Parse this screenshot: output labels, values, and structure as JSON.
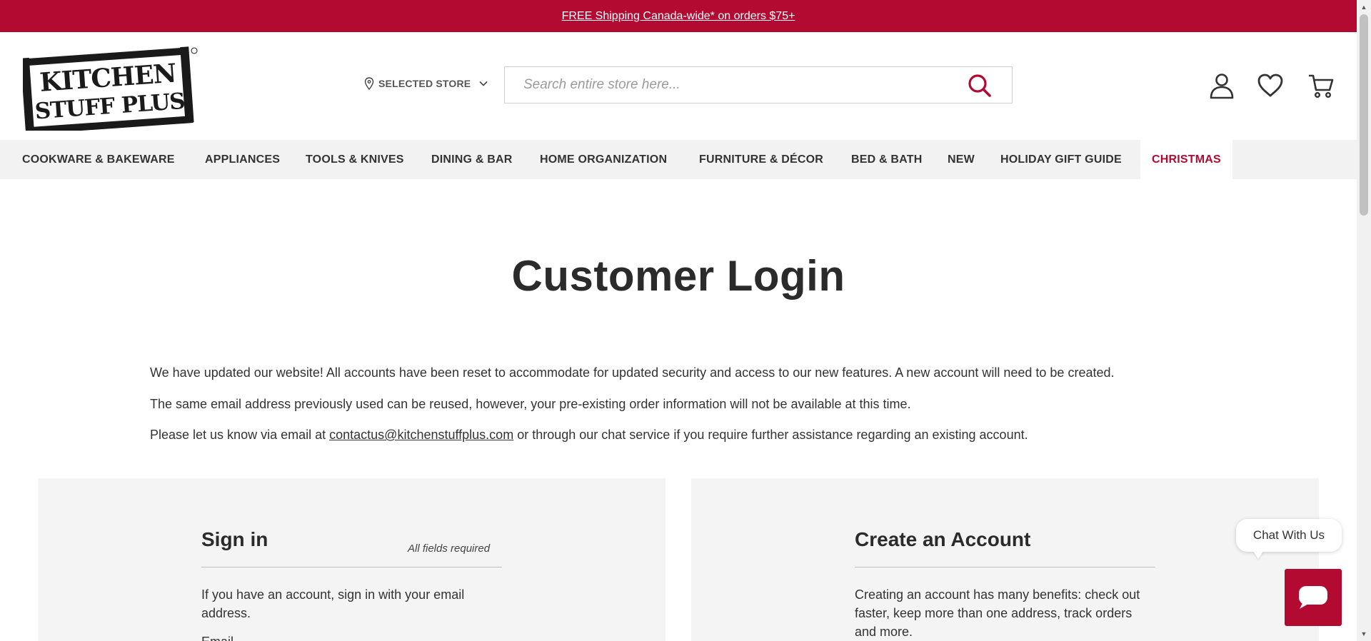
{
  "promo": {
    "text": "FREE Shipping Canada-wide* on orders $75+"
  },
  "header": {
    "logo_alt": "KITCHEN STUFF PLUS",
    "store_label": "SELECTED STORE",
    "search_placeholder": "Search entire store here...",
    "icons": [
      "account-icon",
      "wishlist-heart-icon",
      "cart-icon"
    ]
  },
  "nav": {
    "items": [
      {
        "label": "COOKWARE & BAKEWARE"
      },
      {
        "label": "APPLIANCES"
      },
      {
        "label": "TOOLS & KNIVES"
      },
      {
        "label": "DINING & BAR"
      },
      {
        "label": "HOME ORGANIZATION"
      },
      {
        "label": "FURNITURE & DÉCOR"
      },
      {
        "label": "BED & BATH"
      },
      {
        "label": "NEW"
      },
      {
        "label": "HOLIDAY GIFT GUIDE"
      },
      {
        "label": "CHRISTMAS"
      }
    ]
  },
  "main": {
    "title": "Customer Login",
    "notice_1": "We have updated our website! All accounts have been reset to accommodate for updated security and access to our new features. A new account will need to be created.",
    "notice_2": "The same email address previously used can be reused, however, your pre-existing order information will not be available at this time.",
    "notice_3_prefix": "Please let us know via email at ",
    "notice_3_email": "contactus@kitchenstuffplus.com",
    "notice_3_suffix": " or through our chat service if you require further assistance regarding an existing account."
  },
  "signin": {
    "title": "Sign in",
    "required": "All fields required",
    "intro": "If you have an account, sign in with your email address.",
    "email_label": "Email"
  },
  "create": {
    "title": "Create an Account",
    "intro": "Creating an account has many benefits: check out faster, keep more than one address, track orders and more."
  },
  "chat": {
    "label": "Chat With Us"
  },
  "colors": {
    "brand_red": "#b30a32",
    "nav_bg": "#f2f2f2",
    "panel_bg": "#f4f4f4"
  }
}
